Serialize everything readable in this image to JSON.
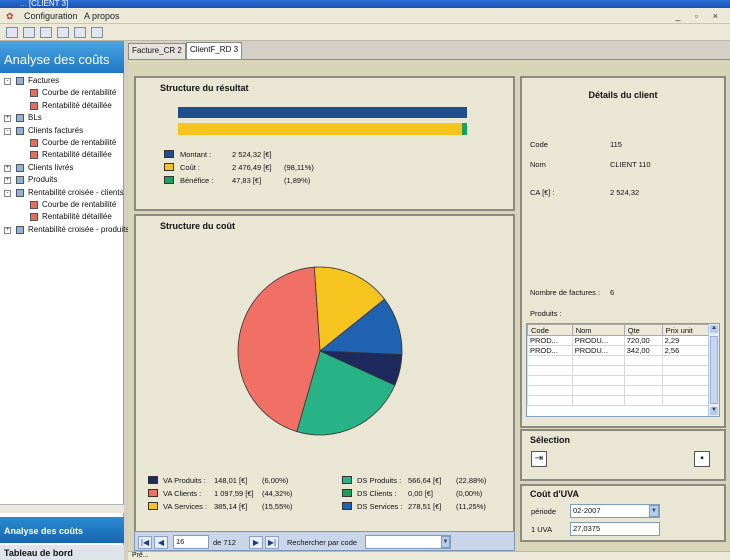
{
  "window": {
    "title": "...  [CLIENT 3]"
  },
  "menu": {
    "configuration": "Configuration",
    "apropos": "A propos"
  },
  "left": {
    "header": "Analyse des coûts",
    "tree": [
      {
        "label": "Factures",
        "level": 0,
        "expander": "-"
      },
      {
        "label": "Courbe de rentabilité",
        "level": 1
      },
      {
        "label": "Rentabilité détaillée",
        "level": 1
      },
      {
        "label": "BLs",
        "level": 0,
        "expander": "+"
      },
      {
        "label": "Clients facturés",
        "level": 0,
        "expander": "-"
      },
      {
        "label": "Courbe de rentabilité",
        "level": 1
      },
      {
        "label": "Rentabilité détaillée",
        "level": 1
      },
      {
        "label": "Clients livrés",
        "level": 0,
        "expander": "+"
      },
      {
        "label": "Produits",
        "level": 0,
        "expander": "+"
      },
      {
        "label": "Rentabilité croisée - clients",
        "level": 0,
        "expander": "-"
      },
      {
        "label": "Courbe de rentabilité",
        "level": 1
      },
      {
        "label": "Rentabilité détaillée",
        "level": 1
      },
      {
        "label": "Rentabilité croisée - produits",
        "level": 0,
        "expander": "+"
      }
    ],
    "nav_active": "Analyse des coûts",
    "nav_other": "Tableau de bord"
  },
  "tabs": [
    "Facture_CR 2",
    "ClientF_RD 3"
  ],
  "result": {
    "title": "Structure du résultat",
    "bars": [
      1.0,
      0.9811
    ],
    "legend": [
      {
        "label": "Montant :",
        "value": "2 524,32 [€]",
        "pct": "",
        "color": "#1f4e8c"
      },
      {
        "label": "Coût :",
        "value": "2 476,49 [€]",
        "pct": "(98,11%)",
        "color": "#f5c41e"
      },
      {
        "label": "Bénéfice :",
        "value": "47,83 [€]",
        "pct": "(1,89%)",
        "color": "#19a05a"
      }
    ]
  },
  "cost": {
    "title": "Structure du coût",
    "slices": [
      {
        "label": "VA Produits :",
        "value": "148,01 [€]",
        "pct": "(6,00%)",
        "share": 6.0,
        "color": "#1e2a5e"
      },
      {
        "label": "VA Clients :",
        "value": "1 097,59 [€]",
        "pct": "(44,32%)",
        "share": 44.32,
        "color": "#f07065"
      },
      {
        "label": "VA Services :",
        "value": "385,14 [€]",
        "pct": "(15,55%)",
        "share": 15.55,
        "color": "#f5c41e"
      },
      {
        "label": "DS Produits :",
        "value": "566,64 [€]",
        "pct": "(22,88%)",
        "share": 22.88,
        "color": "#27b386"
      },
      {
        "label": "DS Clients :",
        "value": "0,00 [€]",
        "pct": "(0,00%)",
        "share": 0,
        "color": "#19a05a"
      },
      {
        "label": "DS Services :",
        "value": "278,51 [€]",
        "pct": "(11,25%)",
        "share": 11.25,
        "color": "#1e62b0"
      }
    ]
  },
  "nav": {
    "record": "16",
    "of": "de 712",
    "search_label": "Rechercher par code"
  },
  "details": {
    "title": "Détails du client",
    "code_label": "Code",
    "code": "115",
    "nom_label": "Nom",
    "nom": "CLIENT 110",
    "ca_label": "CA [€] :",
    "ca": "2 524,32",
    "nbf_label": "Nombre de factures :",
    "nbf": "6",
    "produits_label": "Produits :",
    "columns": [
      "Code",
      "Nom",
      "Qte",
      "Prix unit"
    ],
    "rows": [
      [
        "PROD...",
        "PRODU...",
        "720,00",
        "2,29"
      ],
      [
        "PROD...",
        "PRODU...",
        "342,00",
        "2,56"
      ]
    ]
  },
  "selection": {
    "title": "Sélection"
  },
  "uva": {
    "title": "Coût d'UVA",
    "periode_label": "période",
    "periode": "02-2007",
    "uva_label": "1 UVA",
    "uva": "27,0375"
  },
  "status": "Prê..."
}
